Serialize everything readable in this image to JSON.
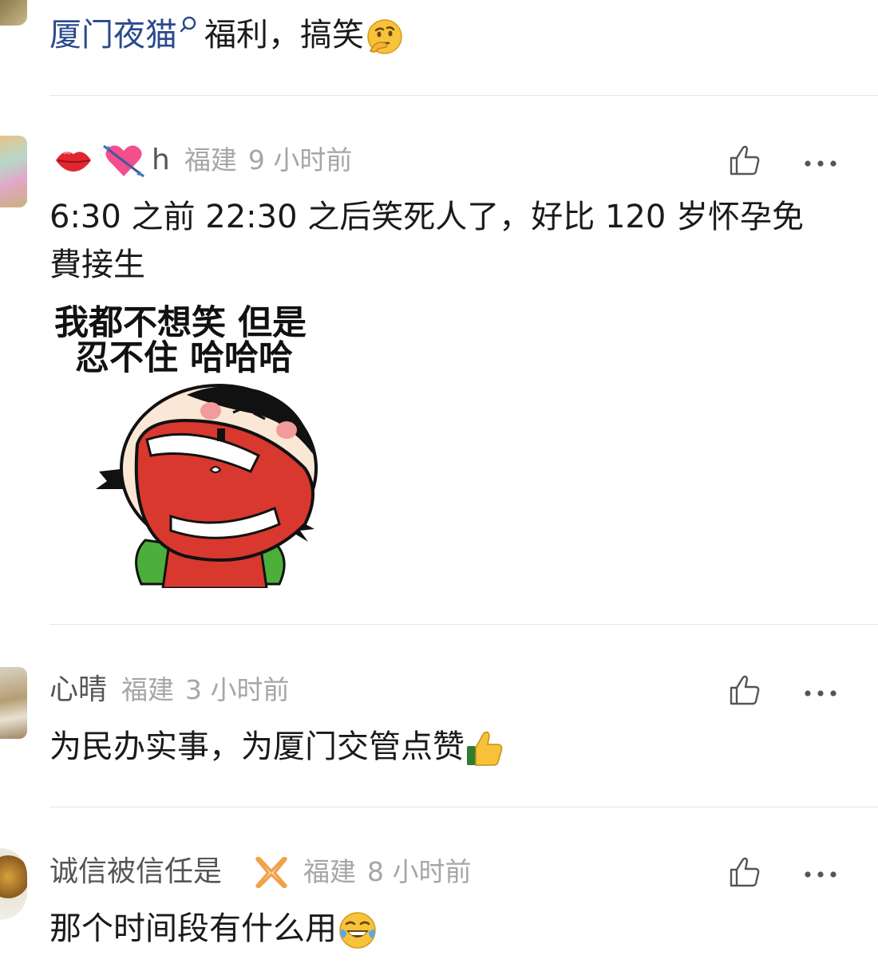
{
  "top_snippet": {
    "link_text": "厦门夜猫",
    "rest_text": "福利，搞笑"
  },
  "comments": [
    {
      "username": "h",
      "location": "福建",
      "time": "9 小时前",
      "text_line1": "6:30 之前 22:30 之后笑死人了，好比 120 岁怀孕免",
      "text_line2": "費接生",
      "sticker": {
        "caption_line1": "我都不想笑 但是",
        "caption_line2": "忍不住 哈哈哈"
      }
    },
    {
      "username": "心晴",
      "location": "福建",
      "time": "3 小时前",
      "text": "为民办实事，为厦门交管点赞"
    },
    {
      "username": "诚信被信任是",
      "location": "福建",
      "time": "8 小时前",
      "text": "那个时间段有什么用"
    }
  ],
  "icons": {
    "search": "search-icon",
    "thinking": "thinking-face-emoji",
    "kiss": "kiss-mark-emoji",
    "heart_arrow": "heart-with-arrow-emoji",
    "thumbs_up_emoji": "thumbs-up-emoji",
    "laughing": "rolling-laughing-emoji",
    "badge": "ribbon-badge-icon",
    "like": "thumb-up-outline-icon",
    "more": "more-dots-icon"
  },
  "colors": {
    "link": "#2b4a8c",
    "meta": "#a6a6a6",
    "divider": "#e5e5e5",
    "icon": "#555555"
  }
}
